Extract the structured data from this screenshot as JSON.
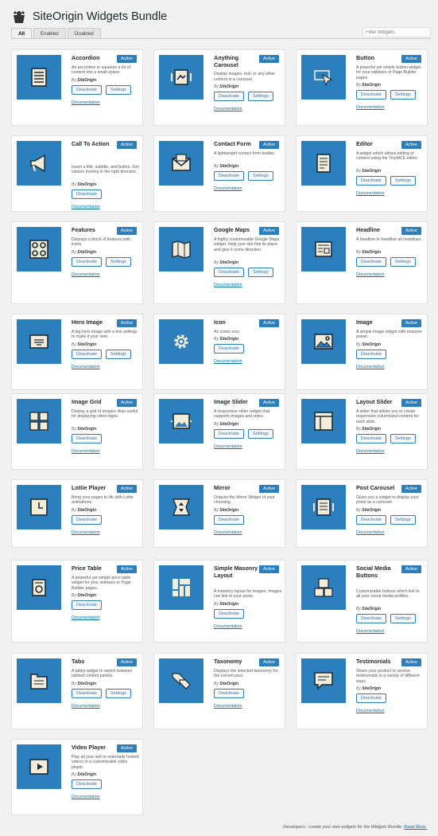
{
  "header": {
    "title": "SiteOrigin Widgets Bundle"
  },
  "tabs": [
    {
      "label": "All",
      "active": true
    },
    {
      "label": "Enabled",
      "active": false
    },
    {
      "label": "Disabled",
      "active": false
    }
  ],
  "filter": {
    "placeholder": "Filter Widgets"
  },
  "labels": {
    "active": "Active",
    "deactivate": "Deactivate",
    "settings": "Settings",
    "documentation": "Documentation",
    "author": "SiteOrigin",
    "by": "By"
  },
  "colors": {
    "accent": "#2b7fbc",
    "link": "#0073aa"
  },
  "widgets": [
    {
      "name": "Accordion",
      "description": "An accordion to squeeze a lot of content into a small space.",
      "settings": true,
      "icon": "accordion-icon"
    },
    {
      "name": "Anything Carousel",
      "description": "Display images, text, or any other content in a carousel.",
      "settings": true,
      "icon": "carousel-icon"
    },
    {
      "name": "Button",
      "description": "A powerful yet simple button widget for your sidebars or Page Builder pages.",
      "settings": true,
      "icon": "button-icon"
    },
    {
      "name": "Call To Action",
      "description": "Insert a title, subtitle, and button. Get visitors moving in the right direction.",
      "settings": false,
      "icon": "megaphone-icon"
    },
    {
      "name": "Contact Form",
      "description": "A lightweight contact form builder.",
      "settings": true,
      "icon": "envelope-icon"
    },
    {
      "name": "Editor",
      "description": "A widget which allows editing of content using the TinyMCE editor.",
      "settings": true,
      "icon": "editor-icon"
    },
    {
      "name": "Features",
      "description": "Displays a block of features with icons.",
      "settings": true,
      "icon": "features-icon"
    },
    {
      "name": "Google Maps",
      "description": "A highly customisable Google Maps widget. Help your site find its place and give it some direction.",
      "settings": true,
      "icon": "map-icon"
    },
    {
      "name": "Headline",
      "description": "A headline to headline all headlines.",
      "settings": true,
      "icon": "newspaper-icon"
    },
    {
      "name": "Hero Image",
      "description": "A big hero image with a few settings to make it your own.",
      "settings": true,
      "icon": "hero-icon"
    },
    {
      "name": "Icon",
      "description": "An iconic icon.",
      "settings": false,
      "icon": "gear-icon"
    },
    {
      "name": "Image",
      "description": "A simple image widget with massive power.",
      "settings": false,
      "icon": "image-icon"
    },
    {
      "name": "Image Grid",
      "description": "Display a grid of images. Also useful for displaying client logos.",
      "settings": false,
      "icon": "image-grid-icon"
    },
    {
      "name": "Image Slider",
      "description": "A responsive slider widget that supports images and video.",
      "settings": true,
      "icon": "slider-icon"
    },
    {
      "name": "Layout Slider",
      "description": "A slider that allows you to create responsive columnized content for each slide.",
      "settings": true,
      "icon": "layout-slider-icon"
    },
    {
      "name": "Lottie Player",
      "description": "Bring your pages to life with Lottie animations.",
      "settings": false,
      "icon": "lottie-icon"
    },
    {
      "name": "Mirror",
      "description": "Outputs the Mirror Widget of your choosing.",
      "settings": false,
      "icon": "mirror-icon"
    },
    {
      "name": "Post Carousel",
      "description": "Gives you a widget to display your posts as a carousel.",
      "settings": true,
      "icon": "post-carousel-icon"
    },
    {
      "name": "Price Table",
      "description": "A powerful yet simple price table widget for your sidebars or Page Builder pages.",
      "settings": false,
      "icon": "price-icon"
    },
    {
      "name": "Simple Masonry Layout",
      "description": "A masonry layout for images. Images can link to your posts.",
      "settings": false,
      "icon": "masonry-icon"
    },
    {
      "name": "Social Media Buttons",
      "description": "Customizable buttons which link to all your social media profiles.",
      "settings": true,
      "icon": "social-icon"
    },
    {
      "name": "Tabs",
      "description": "A tabby widget to switch between tabbed content panels.",
      "settings": true,
      "icon": "tabs-icon"
    },
    {
      "name": "Taxonomy",
      "description": "Displays the selected taxonomy for the current post.",
      "settings": false,
      "icon": "tags-icon"
    },
    {
      "name": "Testimonials",
      "description": "Share your product or service testimonials in a variety of different ways.",
      "settings": false,
      "icon": "testimonial-icon"
    },
    {
      "name": "Video Player",
      "description": "Play all your self or externally hosted videos in a customizable video player.",
      "settings": false,
      "icon": "video-icon"
    }
  ],
  "footer": {
    "text": "Developers - create your own widgets for the Widgets Bundle.",
    "link": "Read More."
  }
}
